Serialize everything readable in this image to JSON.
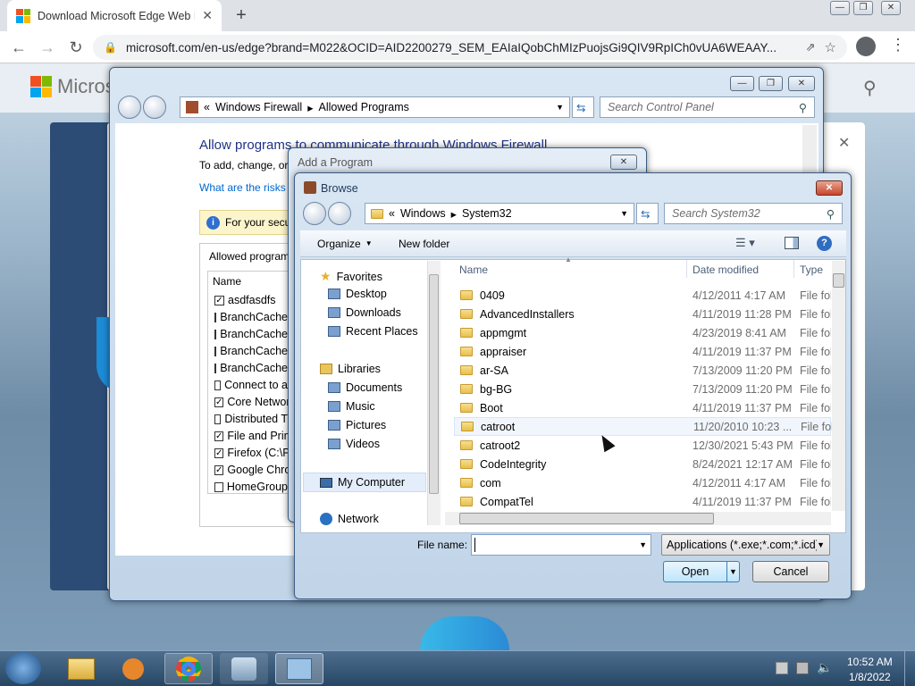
{
  "browser": {
    "tab_title": "Download Microsoft Edge Web B",
    "url": "microsoft.com/en-us/edge?brand=M022&OCID=AID2200279_SEM_EAIaIQobChMIzPuojsGi9QIV9RpICh0vUA6WEAAY..."
  },
  "background_page": {
    "logo_text": "Microso"
  },
  "firewall_window": {
    "breadcrumb": [
      "Windows Firewall",
      "Allowed Programs"
    ],
    "search_placeholder": "Search Control Panel",
    "heading": "Allow programs to communicate through Windows Firewall",
    "subtext": "To add, change, or",
    "link": "What are the risks o",
    "info_text": "For your secu",
    "group_label": "Allowed program",
    "column_name": "Name",
    "programs": [
      {
        "name": "asdfasdfs",
        "checked": true
      },
      {
        "name": "BranchCache",
        "checked": false
      },
      {
        "name": "BranchCache",
        "checked": false
      },
      {
        "name": "BranchCache",
        "checked": false
      },
      {
        "name": "BranchCache",
        "checked": false
      },
      {
        "name": "Connect to a",
        "checked": false
      },
      {
        "name": "Core Networ",
        "checked": true
      },
      {
        "name": "Distributed T",
        "checked": false
      },
      {
        "name": "File and Print",
        "checked": true
      },
      {
        "name": "Firefox (C:\\P",
        "checked": true
      },
      {
        "name": "Google Chro",
        "checked": true
      },
      {
        "name": "HomeGroup",
        "checked": false
      }
    ]
  },
  "add_program_dialog": {
    "title": "Add a Program"
  },
  "browse_dialog": {
    "title": "Browse",
    "breadcrumb": [
      "Windows",
      "System32"
    ],
    "search_placeholder": "Search System32",
    "organize_label": "Organize",
    "new_folder_label": "New folder",
    "nav": {
      "favorites_label": "Favorites",
      "favorites": [
        "Desktop",
        "Downloads",
        "Recent Places"
      ],
      "libraries_label": "Libraries",
      "libraries": [
        "Documents",
        "Music",
        "Pictures",
        "Videos"
      ],
      "computer_label": "My Computer",
      "network_label": "Network"
    },
    "columns": {
      "name": "Name",
      "date": "Date modified",
      "type": "Type"
    },
    "files": [
      {
        "name": "0409",
        "date": "4/12/2011 4:17 AM",
        "type": "File fol"
      },
      {
        "name": "AdvancedInstallers",
        "date": "4/11/2019 11:28 PM",
        "type": "File fol"
      },
      {
        "name": "appmgmt",
        "date": "4/23/2019 8:41 AM",
        "type": "File fol"
      },
      {
        "name": "appraiser",
        "date": "4/11/2019 11:37 PM",
        "type": "File fol"
      },
      {
        "name": "ar-SA",
        "date": "7/13/2009 11:20 PM",
        "type": "File fol"
      },
      {
        "name": "bg-BG",
        "date": "7/13/2009 11:20 PM",
        "type": "File fol"
      },
      {
        "name": "Boot",
        "date": "4/11/2019 11:37 PM",
        "type": "File fol"
      },
      {
        "name": "catroot",
        "date": "11/20/2010 10:23 ...",
        "type": "File fol"
      },
      {
        "name": "catroot2",
        "date": "12/30/2021 5:43 PM",
        "type": "File fol"
      },
      {
        "name": "CodeIntegrity",
        "date": "8/24/2021 12:17 AM",
        "type": "File fol"
      },
      {
        "name": "com",
        "date": "4/12/2011 4:17 AM",
        "type": "File fol"
      },
      {
        "name": "CompatTel",
        "date": "4/11/2019 11:37 PM",
        "type": "File fol"
      }
    ],
    "file_name_label": "File name:",
    "file_name_value": "",
    "file_type": "Applications (*.exe;*.com;*.icd)",
    "open_label": "Open",
    "cancel_label": "Cancel"
  },
  "taskbar": {
    "time": "10:52 AM",
    "date": "1/8/2022"
  },
  "colors": {
    "accent": "#3399ff",
    "win7_title": "#1e395b",
    "link": "#0066cc"
  }
}
